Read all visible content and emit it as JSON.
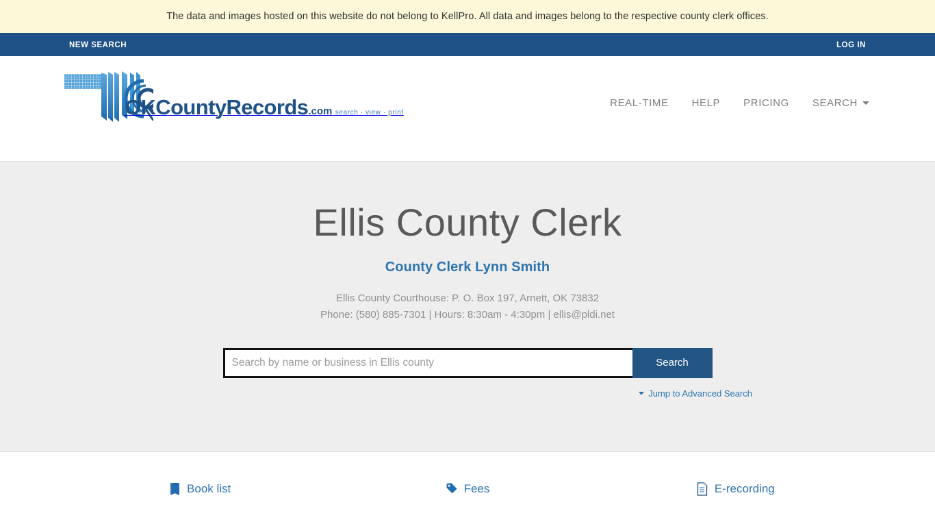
{
  "disclaimer": {
    "text": "The data and images hosted on this website do not belong to KellPro. All data and images belong to the respective county clerk offices."
  },
  "utilbar": {
    "new_search": "NEW SEARCH",
    "log_in": "LOG IN"
  },
  "logo": {
    "wordmark_main": "OKCountyRecords",
    "wordmark_suffix": ".com",
    "tagline": "search · view · print",
    "trademark": "™",
    "icon": "fanned-documents-magnifier-icon"
  },
  "mainnav": {
    "items": [
      {
        "label": "REAL-TIME",
        "icon": ""
      },
      {
        "label": "HELP",
        "icon": ""
      },
      {
        "label": "PRICING",
        "icon": ""
      },
      {
        "label": "SEARCH",
        "icon": "chevron-down-icon"
      }
    ]
  },
  "hero": {
    "title": "Ellis County Clerk",
    "clerk_name": "County Clerk Lynn Smith",
    "address_line": "Ellis County Courthouse: P. O. Box 197, Arnett, OK 73832",
    "contact_line": "Phone: (580) 885-7301 | Hours: 8:30am - 4:30pm | ellis@pldi.net",
    "search": {
      "placeholder": "Search by name or business in Ellis county",
      "value": "",
      "button_label": "Search"
    },
    "advanced_search_label": "Jump to Advanced Search",
    "advanced_search_icon": "caret-down-icon"
  },
  "quicklinks": [
    {
      "label": "Book list",
      "icon": "book-icon"
    },
    {
      "label": "Fees",
      "icon": "price-tag-icon"
    },
    {
      "label": "E-recording",
      "icon": "document-icon"
    }
  ],
  "colors": {
    "banner_bg": "#fcf8d8",
    "nav_blue": "#1f5287",
    "link_blue": "#2e74b0",
    "hero_bg": "#eeeeee",
    "button_blue": "#225484"
  }
}
